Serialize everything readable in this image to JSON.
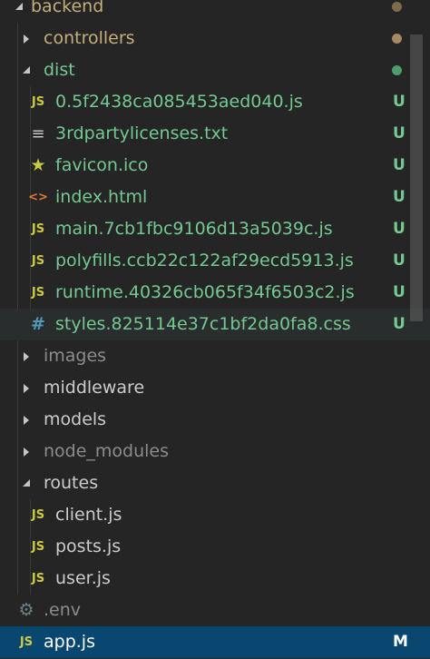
{
  "explorer": {
    "root": {
      "label": "backend",
      "color": "#c5ae7c",
      "status_color": "#7e6a4d"
    },
    "items": [
      {
        "name": "folder-controllers",
        "type": "folder",
        "label": "controllers",
        "indent": 1,
        "expanded": false,
        "color": "#c5ae7c",
        "status": "dot",
        "status_color": "#a48a5e"
      },
      {
        "name": "folder-dist",
        "type": "folder",
        "label": "dist",
        "indent": 1,
        "expanded": true,
        "color": "#73c991",
        "status": "dot",
        "status_color": "#4d9e6c"
      },
      {
        "name": "file-0",
        "type": "file",
        "icon": "js-icon",
        "glyph": "JS",
        "label": "0.5f2438ca085453aed040.js",
        "indent": 2,
        "color": "#73c991",
        "status": "badge",
        "badge": "U"
      },
      {
        "name": "file-3rdpartylicenses",
        "type": "file",
        "icon": "text-file-icon",
        "glyph": "≡",
        "label": "3rdpartylicenses.txt",
        "indent": 2,
        "color": "#73c991",
        "status": "badge",
        "badge": "U"
      },
      {
        "name": "file-favicon",
        "type": "file",
        "icon": "star-icon",
        "glyph": "★",
        "label": "favicon.ico",
        "indent": 2,
        "color": "#73c991",
        "status": "badge",
        "badge": "U"
      },
      {
        "name": "file-index-html",
        "type": "file",
        "icon": "html-icon",
        "glyph": "<>",
        "label": "index.html",
        "indent": 2,
        "color": "#73c991",
        "status": "badge",
        "badge": "U"
      },
      {
        "name": "file-main",
        "type": "file",
        "icon": "js-icon",
        "glyph": "JS",
        "label": "main.7cb1fbc9106d13a5039c.js",
        "indent": 2,
        "color": "#73c991",
        "status": "badge",
        "badge": "U"
      },
      {
        "name": "file-polyfills",
        "type": "file",
        "icon": "js-icon",
        "glyph": "JS",
        "label": "polyfills.ccb22c122af29ecd5913.js",
        "indent": 2,
        "color": "#73c991",
        "status": "badge",
        "badge": "U"
      },
      {
        "name": "file-runtime",
        "type": "file",
        "icon": "js-icon",
        "glyph": "JS",
        "label": "runtime.40326cb065f34f6503c2.js",
        "indent": 2,
        "color": "#73c991",
        "status": "badge",
        "badge": "U"
      },
      {
        "name": "file-styles",
        "type": "file",
        "icon": "css-icon",
        "glyph": "#",
        "label": "styles.825114e37c1bf2da0fa8.css",
        "indent": 2,
        "color": "#73c991",
        "status": "badge",
        "badge": "U",
        "hover": true
      },
      {
        "name": "folder-images",
        "type": "folder",
        "label": "images",
        "indent": 1,
        "expanded": false,
        "color": "#8c8c8c"
      },
      {
        "name": "folder-middleware",
        "type": "folder",
        "label": "middleware",
        "indent": 1,
        "expanded": false,
        "color": "#cccccc"
      },
      {
        "name": "folder-models",
        "type": "folder",
        "label": "models",
        "indent": 1,
        "expanded": false,
        "color": "#cccccc"
      },
      {
        "name": "folder-node-modules",
        "type": "folder",
        "label": "node_modules",
        "indent": 1,
        "expanded": false,
        "color": "#8c8c8c"
      },
      {
        "name": "folder-routes",
        "type": "folder",
        "label": "routes",
        "indent": 1,
        "expanded": true,
        "color": "#cccccc"
      },
      {
        "name": "file-client",
        "type": "file",
        "icon": "js-icon",
        "glyph": "JS",
        "label": "client.js",
        "indent": 2,
        "color": "#cccccc"
      },
      {
        "name": "file-posts",
        "type": "file",
        "icon": "js-icon",
        "glyph": "JS",
        "label": "posts.js",
        "indent": 2,
        "color": "#cccccc"
      },
      {
        "name": "file-user",
        "type": "file",
        "icon": "js-icon",
        "glyph": "JS",
        "label": "user.js",
        "indent": 2,
        "color": "#cccccc"
      },
      {
        "name": "file-env",
        "type": "file",
        "icon": "gear-icon",
        "glyph": "⚙",
        "label": ".env",
        "indent": 1,
        "color": "#8c8c8c"
      },
      {
        "name": "file-app",
        "type": "file",
        "icon": "js-icon",
        "glyph": "JS",
        "label": "app.js",
        "indent": 1,
        "color": "#e2c08d",
        "status": "badge",
        "badge": "M",
        "selected": true
      }
    ]
  },
  "icon_colors": {
    "js-icon": "#cbcb41",
    "text-file-icon": "#c5c5c5",
    "star-icon": "#cbcb41",
    "html-icon": "#e37933",
    "css-icon": "#519aba",
    "gear-icon": "#6d8086"
  }
}
